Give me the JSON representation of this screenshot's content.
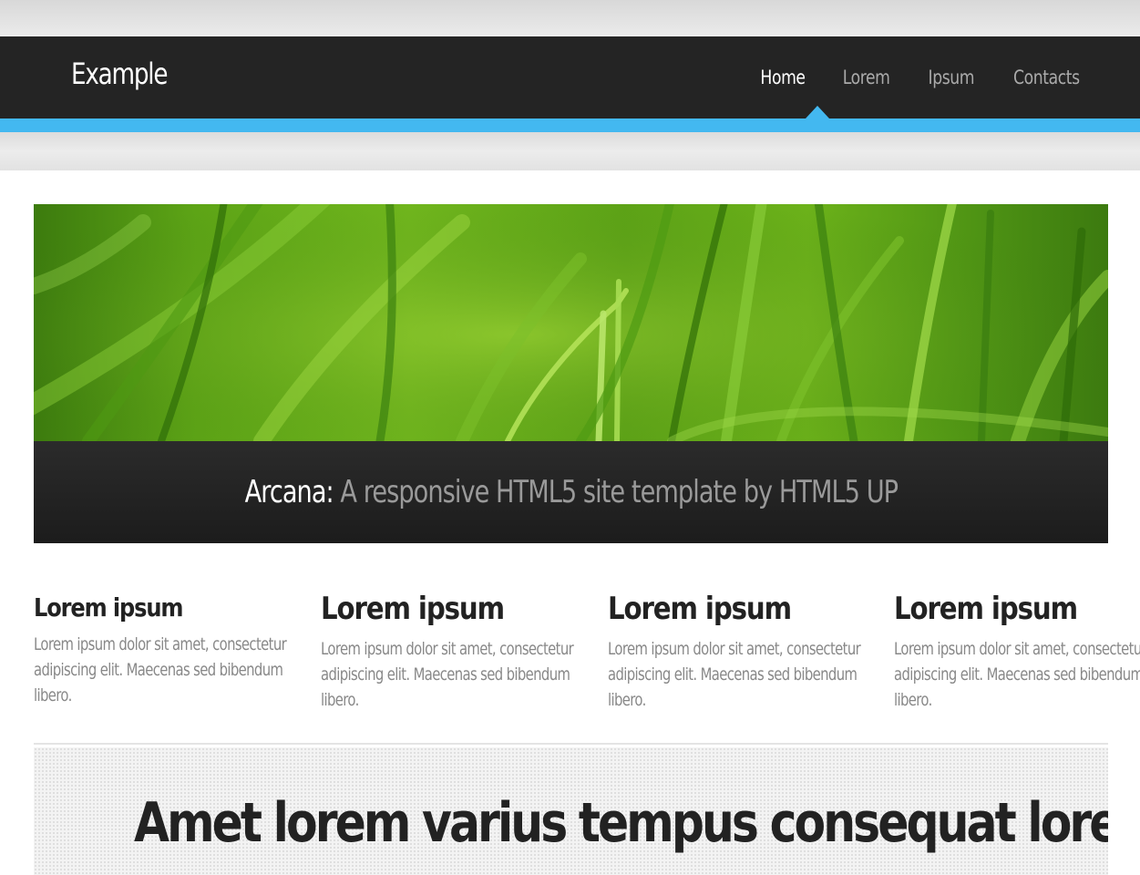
{
  "site": {
    "logo": "Example"
  },
  "nav": {
    "items": [
      {
        "label": "Home",
        "active": true
      },
      {
        "label": "Lorem",
        "active": false
      },
      {
        "label": "Ipsum",
        "active": false
      },
      {
        "label": "Contacts",
        "active": false
      }
    ]
  },
  "banner": {
    "caption_strong": "Arcana:",
    "caption_rest": " A responsive HTML5 site template by HTML5 UP"
  },
  "features": [
    {
      "title": "Lorem ipsum",
      "text": "Lorem ipsum dolor sit amet, consectetur adipiscing elit. Maecenas sed bibendum libero."
    },
    {
      "title": "Lorem ipsum",
      "text": "Lorem ipsum dolor sit amet, consectetur adipiscing elit. Maecenas sed bibendum libero."
    },
    {
      "title": "Lorem ipsum",
      "text": "Lorem ipsum dolor sit amet, consectetur adipiscing elit. Maecenas sed bibendum libero."
    },
    {
      "title": "Lorem ipsum",
      "text": "Lorem ipsum dolor sit amet, consectetur adipiscing elit. Maecenas sed bibendum libero."
    }
  ],
  "cta": {
    "title": "Amet lorem varius tempus consequat lorem?"
  },
  "colors": {
    "accent": "#43b8f0",
    "header_bg": "#242424"
  }
}
